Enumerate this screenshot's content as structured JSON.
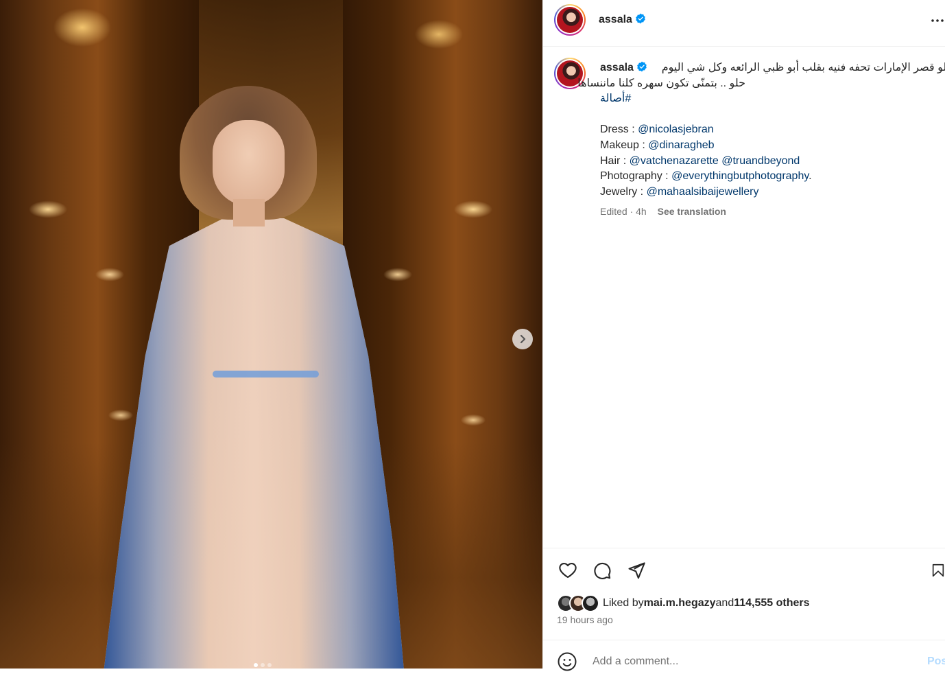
{
  "post": {
    "username": "assala",
    "media": {
      "slides_count": 3,
      "active_slide": 1
    }
  },
  "caption": {
    "username": "assala",
    "arabic_line_1": "المكان حلو قصر الإمارات تحفه فنيه بقلب أبو ظبي الرائعه وكل شي اليوم",
    "arabic_line_2": "حلو .. بتمنّى تكون سهره كلنا ماننساها",
    "hashtag": "#أصالة",
    "credits": [
      {
        "label": "Dress : ",
        "mentions": [
          "@nicolasjebran"
        ],
        "suffix": ""
      },
      {
        "label": "Makeup : ",
        "mentions": [
          "@dinaragheb"
        ],
        "suffix": ""
      },
      {
        "label": "Hair : ",
        "mentions": [
          "@vatchenazarette",
          "@truandbeyond"
        ],
        "suffix": ""
      },
      {
        "label": "Photography : ",
        "mentions": [
          "@everythingbutphotography"
        ],
        "suffix": "."
      },
      {
        "label": "Jewelry : ",
        "mentions": [
          "@mahaalsibaijewellery"
        ],
        "suffix": ""
      }
    ],
    "meta": "Edited · 4h",
    "see_translation": "See translation"
  },
  "actions": {
    "icons": [
      "heart-icon",
      "comment-icon",
      "share-icon",
      "bookmark-icon"
    ]
  },
  "likes": {
    "prefix": "Liked by ",
    "user": "mai.m.hegazy",
    "middle": " and ",
    "count": "114,555 others"
  },
  "time_ago": "19 hours ago",
  "comment": {
    "placeholder": "Add a comment...",
    "post_label": "Post"
  },
  "colors": {
    "link": "#00376b",
    "verified": "#0095f6",
    "muted": "#737373",
    "post_disabled": "#b3dbff"
  }
}
